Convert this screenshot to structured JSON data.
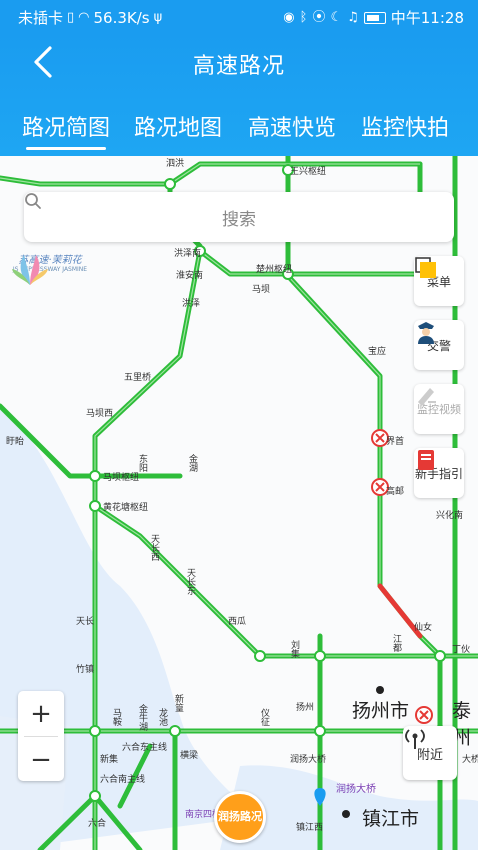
{
  "status_bar": {
    "carrier": "未插卡",
    "speed": "56.3K/s",
    "time": "中午11:28"
  },
  "header": {
    "title": "高速路况",
    "tabs": [
      {
        "label": "路况简图",
        "active": true
      },
      {
        "label": "路况地图",
        "active": false
      },
      {
        "label": "高速快览",
        "active": false
      },
      {
        "label": "监控快拍",
        "active": false
      }
    ]
  },
  "search": {
    "placeholder": "搜索"
  },
  "side_buttons": {
    "menu": "菜单",
    "police": "交警",
    "cctv": "监控视频",
    "guide": "新手指引"
  },
  "zoom": {
    "in": "+",
    "out": "−"
  },
  "nearby": "附近",
  "logo": {
    "name": "苏高速·茉莉花",
    "sub": "JS EXPRESSWAY JASMINE"
  },
  "badge": {
    "text": "润扬路况"
  },
  "cities": {
    "yangzhou": "扬州市",
    "taizhou": "泰州",
    "zhenjiang": "镇江市"
  },
  "bridge": "润扬大桥",
  "map_labels": {
    "hubs": [
      "王兴枢纽",
      "楚州枢纽",
      "马坝枢纽",
      "黄花塘枢纽",
      "南京四桥",
      "六合东主线",
      "六合南主线"
    ],
    "towns": [
      "洪泽南",
      "淮安南",
      "洪泽",
      "五里桥",
      "马坝西",
      "东阳",
      "金湖",
      "盱眙",
      "天长西",
      "天长东",
      "天长",
      "竹镇",
      "马鞍",
      "金牛湖",
      "龙池",
      "六合",
      "新篁",
      "横梁",
      "刘集",
      "仪征",
      "西瓜",
      "扬州",
      "高邮",
      "宝应",
      "界首",
      "江都",
      "仙女",
      "丁伙",
      "兴化南",
      "新集",
      "大桥",
      "润扬大桥",
      "镇江西",
      "泗洪",
      "马坝"
    ]
  }
}
